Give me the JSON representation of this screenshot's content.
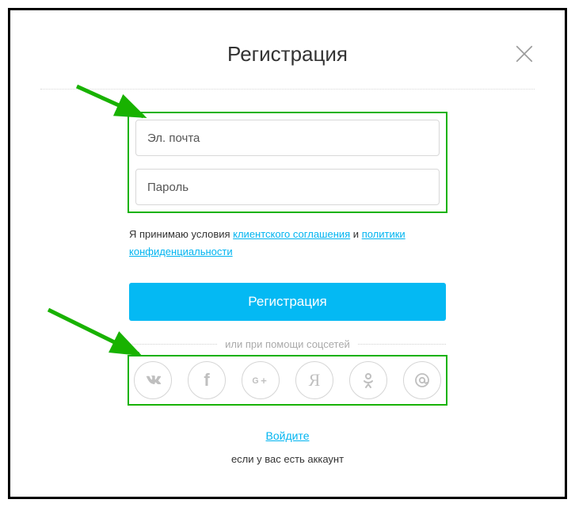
{
  "title": "Регистрация",
  "inputs": {
    "email_placeholder": "Эл. почта",
    "password_placeholder": "Пароль"
  },
  "terms": {
    "prefix": "Я принимаю условия ",
    "link1": "клиентского соглашения",
    "mid": " и ",
    "link2": "политики конфиденциальности"
  },
  "submit_label": "Регистрация",
  "social_sep": "или при помощи соцсетей",
  "social": {
    "vk": "vk-icon",
    "fb": "facebook-icon",
    "gplus": "google-plus-icon",
    "yandex": "yandex-icon",
    "ok": "odnoklassniki-icon",
    "mailru": "mailru-icon"
  },
  "login_link": "Войдите",
  "have_account": "если у вас есть аккаунт"
}
